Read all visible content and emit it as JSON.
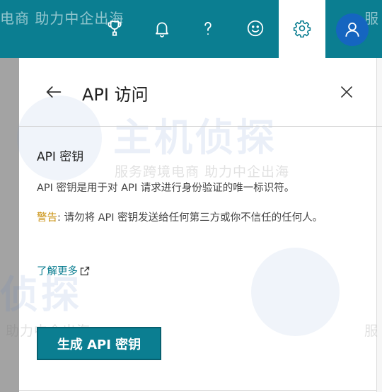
{
  "topbar": {
    "watermark_left": "电商 助力中企出海",
    "watermark_right": "服",
    "icons": [
      "trophy-icon",
      "bell-icon",
      "help-icon",
      "smiley-icon",
      "gear-icon",
      "user-icon"
    ]
  },
  "panel": {
    "title": "API 访问",
    "section_title": "API 密钥",
    "description": "API 密钥是用于对 API 请求进行身份验证的唯一标识符。",
    "warning_label": "警告",
    "warning_text": ": 请勿将 API 密钥发送给任何第三方或你不信任的任何人。",
    "learn_more": "了解更多",
    "generate_button": "生成 API 密钥"
  },
  "watermark": {
    "brand": "主机侦探",
    "brand_short": "侦探",
    "tagline": "服务跨境电商 助力中企出海",
    "tagline_short": "助力中企出海",
    "right_fragment": "服"
  },
  "colors": {
    "topbar": "#0b7e91",
    "accent": "#0b7e91",
    "warning": "#c9900e",
    "avatar": "#1565c0"
  }
}
